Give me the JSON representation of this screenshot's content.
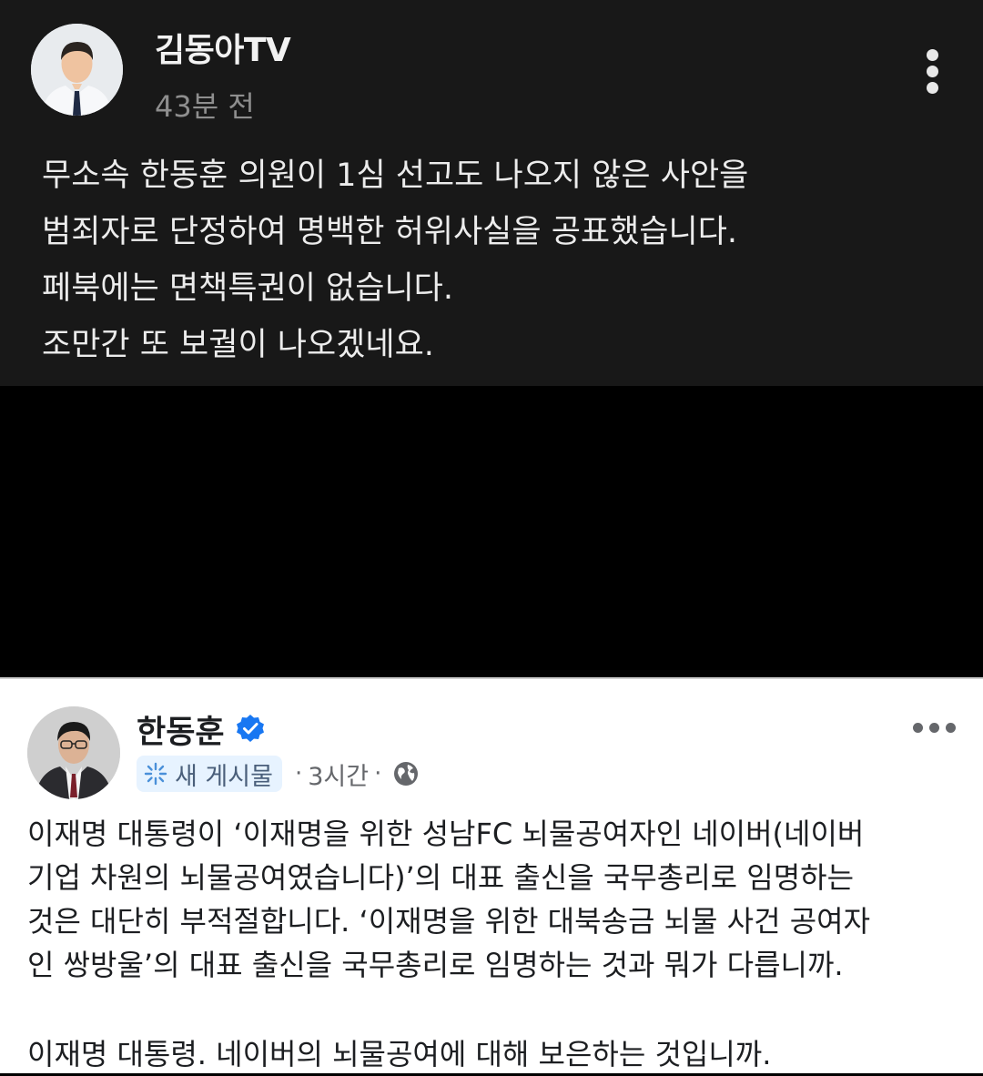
{
  "top_post": {
    "author": "김동아TV",
    "time": "43분 전",
    "lines": [
      "무소속 한동훈 의원이 1심 선고도 나오지 않은 사안을",
      "범죄자로 단정하여 명백한 허위사실을 공표했습니다.",
      "페북에는 면책특권이 없습니다.",
      "조만간 또 보궐이 나오겠네요."
    ]
  },
  "bottom_post": {
    "author": "한동훈",
    "badge": "새 게시물",
    "separator": "·",
    "time": "3시간",
    "separator2": "·",
    "paragraph1_lines": [
      "이재명 대통령이 ‘이재명을 위한 성남FC 뇌물공여자인 네이버(네이버",
      "기업 차원의 뇌물공여였습니다)’의 대표 출신을 국무총리로 임명하는",
      "것은 대단히 부적절합니다. ‘이재명을 위한 대북송금 뇌물 사건 공여자",
      "인 쌍방울’의 대표 출신을 국무총리로 임명하는 것과 뭐가 다릅니까."
    ],
    "paragraph2_lines": [
      "이재명 대통령. 네이버의 뇌물공여에 대해 보은하는 것입니까."
    ]
  },
  "colors": {
    "dark_bg": "#181818",
    "gap_bg": "#000000",
    "light_bg": "#ffffff",
    "verified_blue": "#1877f2",
    "badge_bg": "#e7f3ff"
  },
  "icons": [
    "more-vertical-icon",
    "verified-badge-icon",
    "sparkle-icon",
    "globe-icon",
    "more-horizontal-icon"
  ]
}
